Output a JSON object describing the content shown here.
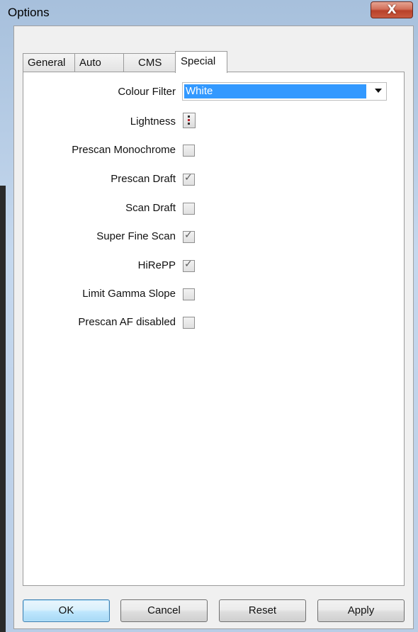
{
  "window": {
    "title": "Options",
    "close_glyph": "X"
  },
  "tabs": [
    {
      "label": "General",
      "active": false
    },
    {
      "label": "Auto",
      "active": false
    },
    {
      "label": "CMS",
      "active": false
    },
    {
      "label": "Special",
      "active": true
    }
  ],
  "special": {
    "colour_filter": {
      "label": "Colour Filter",
      "value": "White"
    },
    "lightness": {
      "label": "Lightness",
      "icon": "lightness-adjust-icon"
    },
    "options": [
      {
        "label": "Prescan Monochrome",
        "checked": false
      },
      {
        "label": "Prescan Draft",
        "checked": true
      },
      {
        "label": "Scan Draft",
        "checked": false
      },
      {
        "label": "Super Fine Scan",
        "checked": true
      },
      {
        "label": "HiRePP",
        "checked": true
      },
      {
        "label": "Limit Gamma Slope",
        "checked": false
      },
      {
        "label": "Prescan AF disabled",
        "checked": false
      }
    ]
  },
  "buttons": {
    "ok": "OK",
    "cancel": "Cancel",
    "reset": "Reset",
    "apply": "Apply"
  },
  "colors": {
    "selection": "#3399ff",
    "titlebar": "#b9cde6",
    "close": "#c85a3f"
  }
}
